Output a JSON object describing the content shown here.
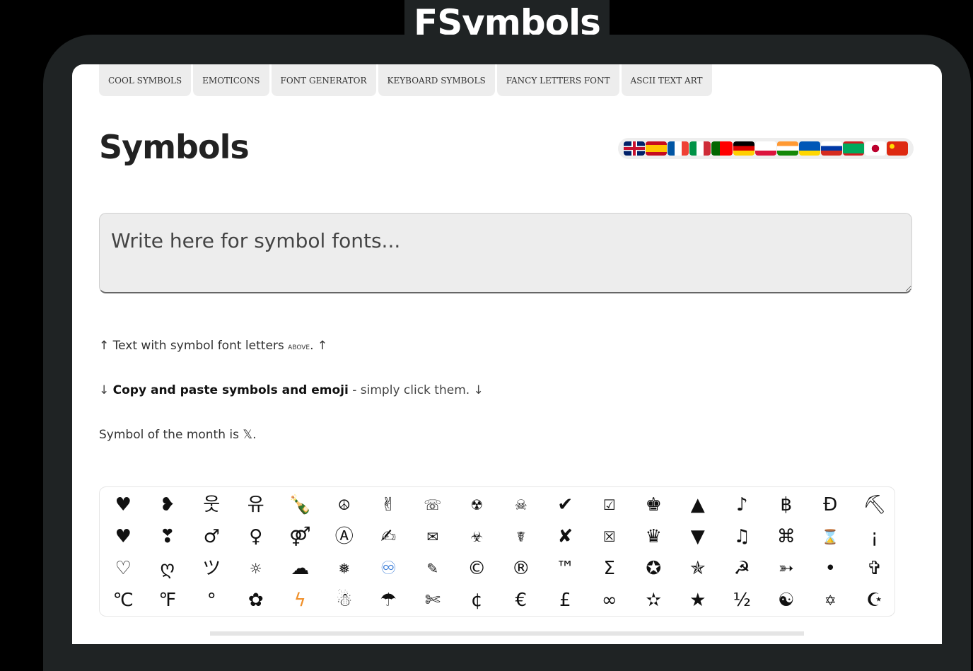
{
  "logo": {
    "text": "FSymbols"
  },
  "nav": {
    "items": [
      {
        "label": "COOL SYMBOLS",
        "name": "nav-cool-symbols"
      },
      {
        "label": "EMOTICONS",
        "name": "nav-emoticons"
      },
      {
        "label": "FONT GENERATOR",
        "name": "nav-font-generator"
      },
      {
        "label": "KEYBOARD SYMBOLS",
        "name": "nav-keyboard-symbols"
      },
      {
        "label": "FANCY LETTERS FONT",
        "name": "nav-fancy-letters-font"
      },
      {
        "label": "ASCII TEXT ART",
        "name": "nav-ascii-text-art"
      }
    ]
  },
  "page": {
    "title": "Symbols",
    "input_placeholder": "Write here for symbol fonts...",
    "line1_prefix": "↑ Text with symbol font letters ",
    "line1_smallcaps": "above",
    "line1_suffix": ". ↑",
    "line2_arrow": "↓ ",
    "line2_bold": "Copy and paste symbols and emoji",
    "line2_rest": " - simply click them. ↓",
    "line3": "Symbol of the month is 𝕏."
  },
  "flags": [
    {
      "name": "flag-uk",
      "colors": [
        "#012169",
        "#ffffff",
        "#c8102e"
      ]
    },
    {
      "name": "flag-spain",
      "colors": [
        "#c60b1e",
        "#ffc400",
        "#c60b1e"
      ]
    },
    {
      "name": "flag-france",
      "colors": [
        "#0055a4",
        "#ffffff",
        "#ef4135"
      ]
    },
    {
      "name": "flag-italy",
      "colors": [
        "#009246",
        "#ffffff",
        "#ce2b37"
      ]
    },
    {
      "name": "flag-portugal",
      "colors": [
        "#006600",
        "#ff0000",
        "#ff0000"
      ]
    },
    {
      "name": "flag-germany",
      "colors": [
        "#000000",
        "#dd0000",
        "#ffce00"
      ]
    },
    {
      "name": "flag-poland",
      "colors": [
        "#ffffff",
        "#ffffff",
        "#dc143c"
      ]
    },
    {
      "name": "flag-india",
      "colors": [
        "#ff9933",
        "#ffffff",
        "#138808"
      ]
    },
    {
      "name": "flag-ukraine",
      "colors": [
        "#0057b7",
        "#0057b7",
        "#ffd700"
      ]
    },
    {
      "name": "flag-russia",
      "colors": [
        "#ffffff",
        "#0039a6",
        "#d52b1e"
      ]
    },
    {
      "name": "flag-mauritania",
      "colors": [
        "#d01c1f",
        "#00a95c",
        "#d01c1f"
      ]
    },
    {
      "name": "flag-japan",
      "colors": [
        "#ffffff",
        "#bc002d",
        "#ffffff"
      ]
    },
    {
      "name": "flag-china",
      "colors": [
        "#de2910",
        "#de2910",
        "#de2910"
      ]
    }
  ],
  "symbols": [
    "♥",
    "❥",
    "웃",
    "유",
    "🍾",
    "☮",
    "✌",
    "☏",
    "☢",
    "☠",
    "✔",
    "☑",
    "♚",
    "▲",
    "♪",
    "฿",
    "Ɖ",
    "⛏",
    "♥",
    "❣",
    "♂",
    "♀",
    "⚤",
    "Ⓐ",
    "✍",
    "✉",
    "☣",
    "☤",
    "✘",
    "☒",
    "♛",
    "▼",
    "♫",
    "⌘",
    "⌛",
    "¡",
    "♡",
    "ღ",
    "ツ",
    "☼",
    "☁",
    "❅",
    "♾",
    "✎",
    "©",
    "®",
    "™",
    "Σ",
    "✪",
    "✯",
    "☭",
    "➳",
    "•",
    "✞",
    "℃",
    "℉",
    "°",
    "✿",
    "ϟ",
    "☃",
    "☂",
    "✄",
    "¢",
    "€",
    "£",
    "∞",
    "✫",
    "★",
    "½",
    "☯",
    "✡",
    "☪"
  ]
}
